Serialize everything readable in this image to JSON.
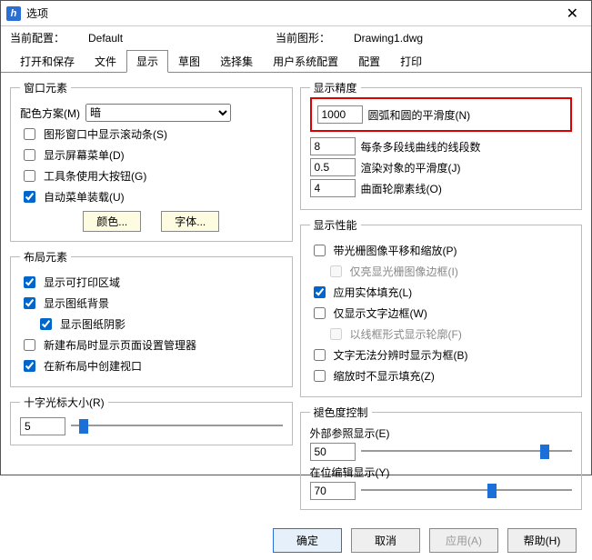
{
  "window": {
    "title": "选项"
  },
  "config": {
    "current_config_label": "当前配置：",
    "current_config_value": "Default",
    "current_drawing_label": "当前图形：",
    "current_drawing_value": "Drawing1.dwg"
  },
  "tabs": [
    "打开和保存",
    "文件",
    "显示",
    "草图",
    "选择集",
    "用户系统配置",
    "配置",
    "打印"
  ],
  "active_tab": 2,
  "window_elements": {
    "legend": "窗口元素",
    "scheme_label": "配色方案(M)",
    "scheme_value": "暗",
    "scrollbars": "图形窗口中显示滚动条(S)",
    "screen_menu": "显示屏幕菜单(D)",
    "large_buttons": "工具条使用大按钮(G)",
    "auto_menu_load": "自动菜单装载(U)",
    "color_btn": "颜色...",
    "font_btn": "字体..."
  },
  "layout_elements": {
    "legend": "布局元素",
    "printable_area": "显示可打印区域",
    "paper_bg": "显示图纸背景",
    "paper_shadow": "显示图纸阴影",
    "page_setup_mgr": "新建布局时显示页面设置管理器",
    "create_viewport": "在新布局中创建视口"
  },
  "crosshair": {
    "legend": "十字光标大小(R)",
    "value": "5"
  },
  "display_precision": {
    "legend": "显示精度",
    "arc_smooth_value": "1000",
    "arc_smooth_label": "圆弧和圆的平滑度(N)",
    "polyline_segs_value": "8",
    "polyline_segs_label": "每条多段线曲线的线段数",
    "render_smooth_value": "0.5",
    "render_smooth_label": "渲染对象的平滑度(J)",
    "surface_lines_value": "4",
    "surface_lines_label": "曲面轮廓素线(O)"
  },
  "display_perf": {
    "legend": "显示性能",
    "pan_zoom_raster": "带光栅图像平移和缩放(P)",
    "highlight_raster": "仅亮显光栅图像边框(I)",
    "solid_fill": "应用实体填充(L)",
    "text_frame": "仅显示文字边框(W)",
    "wireframe_silh": "以线框形式显示轮廓(F)",
    "text_no_distinguish": "文字无法分辨时显示为框(B)",
    "zoom_no_fill": "缩放时不显示填充(Z)"
  },
  "fade": {
    "legend": "褪色度控制",
    "xref_label": "外部参照显示(E)",
    "xref_value": "50",
    "inplace_label": "在位编辑显示(Y)",
    "inplace_value": "70"
  },
  "footer": {
    "ok": "确定",
    "cancel": "取消",
    "apply": "应用(A)",
    "help": "帮助(H)"
  }
}
